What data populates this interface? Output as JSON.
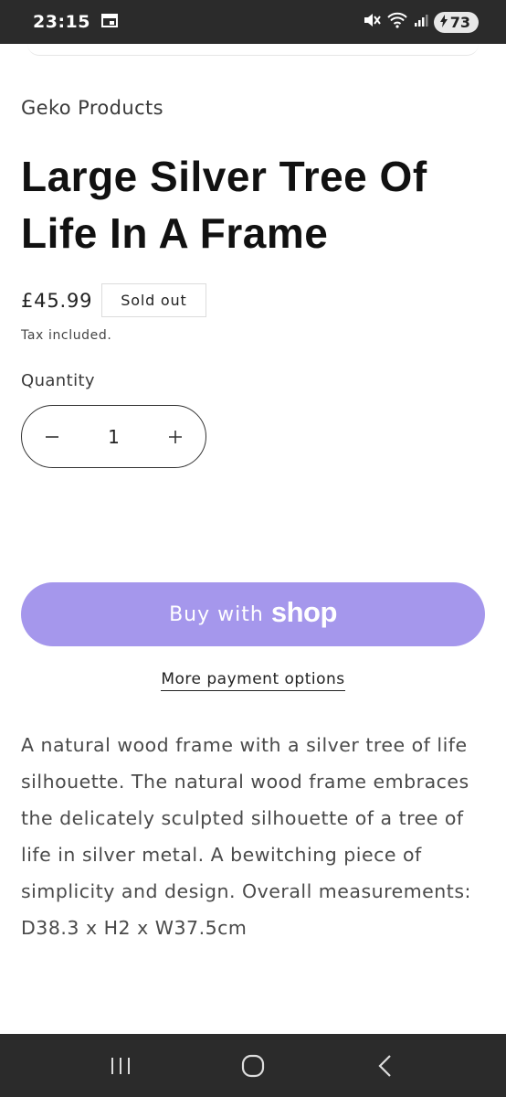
{
  "status_bar": {
    "time": "23:15",
    "battery": "73",
    "icons": [
      "calendar-icon",
      "mute-icon",
      "wifi-icon",
      "signal-icon",
      "battery-charging-icon"
    ]
  },
  "product": {
    "vendor": "Geko Products",
    "title": "Large Silver Tree Of Life In A Frame",
    "price": "£45.99",
    "badge": "Sold out",
    "tax_note": "Tax included.",
    "quantity_label": "Quantity",
    "quantity_value": "1",
    "decrease_symbol": "−",
    "increase_symbol": "+"
  },
  "checkout": {
    "buy_with": "Buy with",
    "shop_brand": "shop",
    "more_payment_options": "More payment options",
    "button_color": "#a597ec"
  },
  "description": "A natural wood frame with a silver tree of life silhouette. The natural wood frame embraces the delicately sculpted silhouette of a tree of life in silver metal. A bewitching piece of simplicity and design. Overall measurements: D38.3 x H2 x W37.5cm",
  "nav_bar": {
    "icons": [
      "recent-apps-icon",
      "home-icon",
      "back-icon"
    ]
  }
}
